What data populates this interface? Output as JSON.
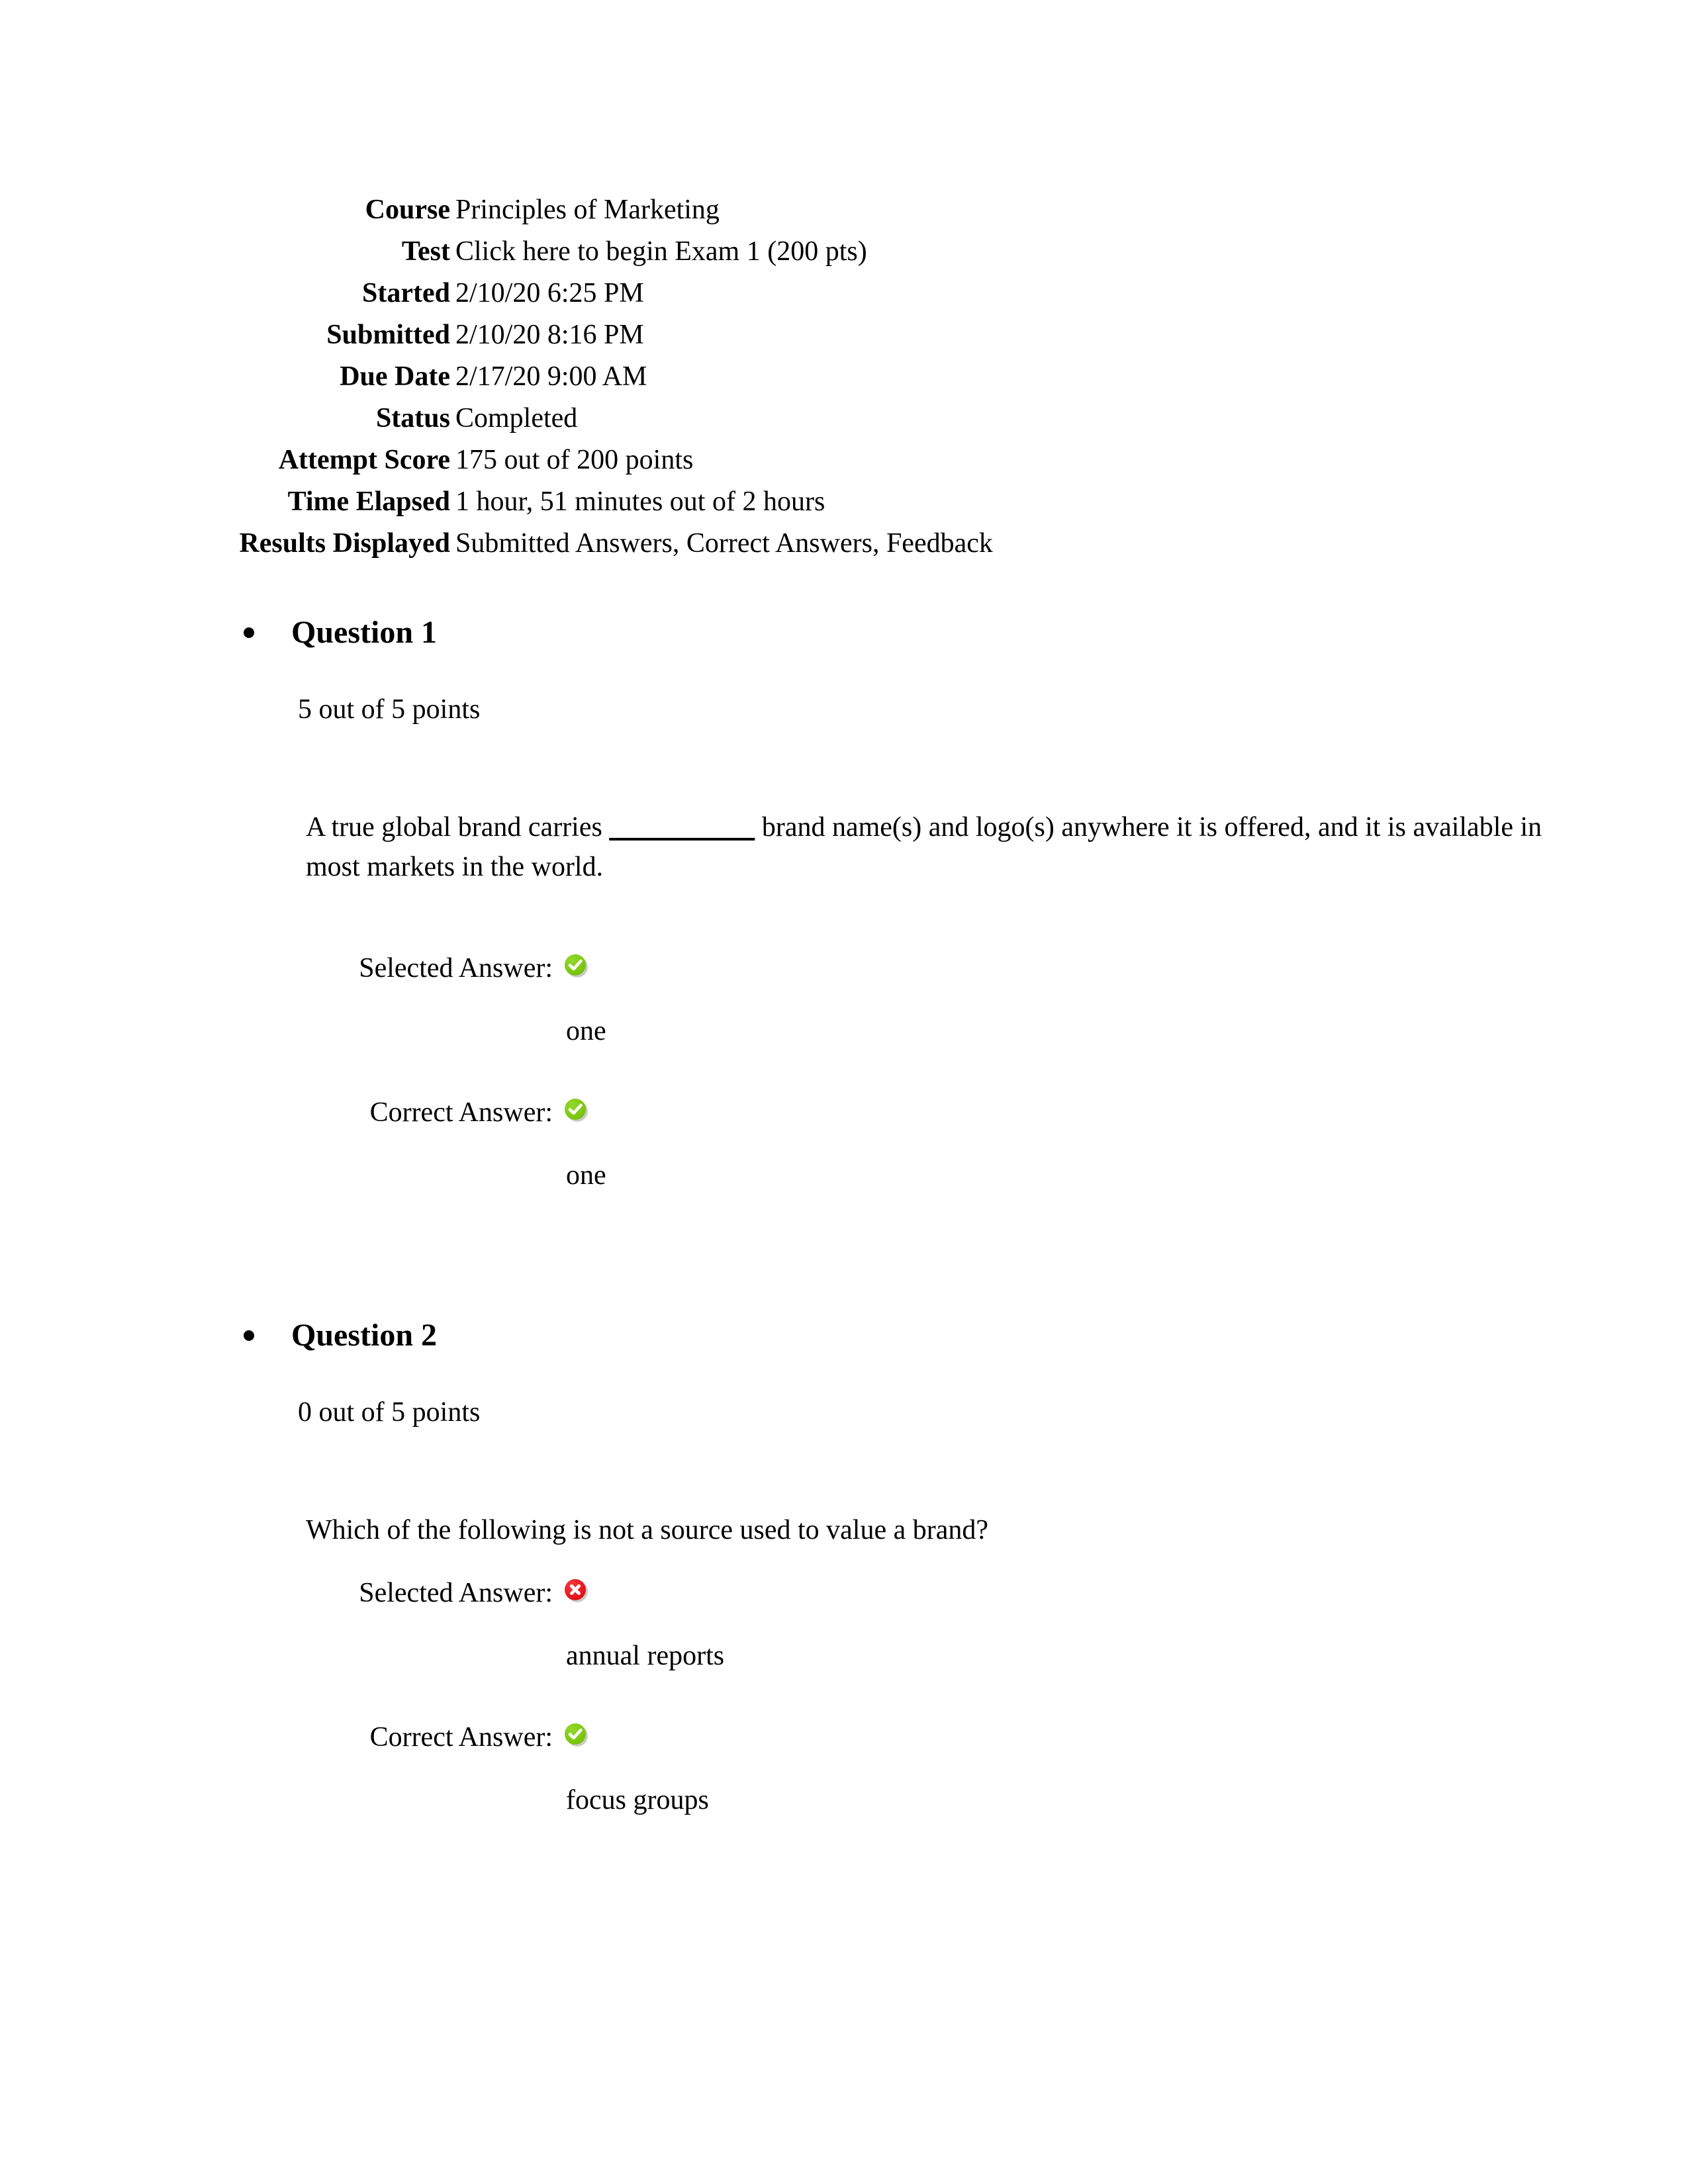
{
  "header": {
    "rows": [
      {
        "label": "Course",
        "value": "Principles of Marketing"
      },
      {
        "label": "Test",
        "value": "Click here to begin Exam 1 (200 pts)"
      },
      {
        "label": "Started",
        "value": "2/10/20 6:25 PM"
      },
      {
        "label": "Submitted",
        "value": "2/10/20 8:16 PM"
      },
      {
        "label": "Due Date",
        "value": "2/17/20 9:00 AM"
      },
      {
        "label": "Status",
        "value": "Completed"
      },
      {
        "label": "Attempt Score",
        "value": "175 out of 200 points"
      },
      {
        "label": "Time Elapsed",
        "value": "1 hour, 51 minutes out of 2 hours"
      },
      {
        "label": "Results Displayed",
        "value": "Submitted Answers, Correct Answers, Feedback"
      }
    ]
  },
  "questions": [
    {
      "title": "Question 1",
      "points": "5 out of 5 points",
      "text_before_blank": "A true global brand carries ",
      "blank": "__________",
      "text_after_blank": " brand name(s) and logo(s) anywhere it is offered, and it is available in most markets in the world.",
      "selected_label": "Selected Answer:",
      "selected_value": "one",
      "selected_icon": "correct-check-icon",
      "correct_label": "Correct Answer:",
      "correct_value": "one",
      "correct_icon": "correct-check-icon"
    },
    {
      "title": "Question 2",
      "points": "0 out of 5 points",
      "text_before_blank": "Which of the following is not a source used to value a brand?",
      "blank": "",
      "text_after_blank": "",
      "selected_label": "Selected Answer:",
      "selected_value": "annual reports",
      "selected_icon": "incorrect-x-icon",
      "correct_label": "Correct Answer:",
      "correct_value": "focus groups",
      "correct_icon": "correct-check-icon"
    }
  ],
  "colors": {
    "correct_green": "#7ac70c",
    "incorrect_red": "#e8141a",
    "text_black": "#000000",
    "page_background": "#ffffff"
  }
}
